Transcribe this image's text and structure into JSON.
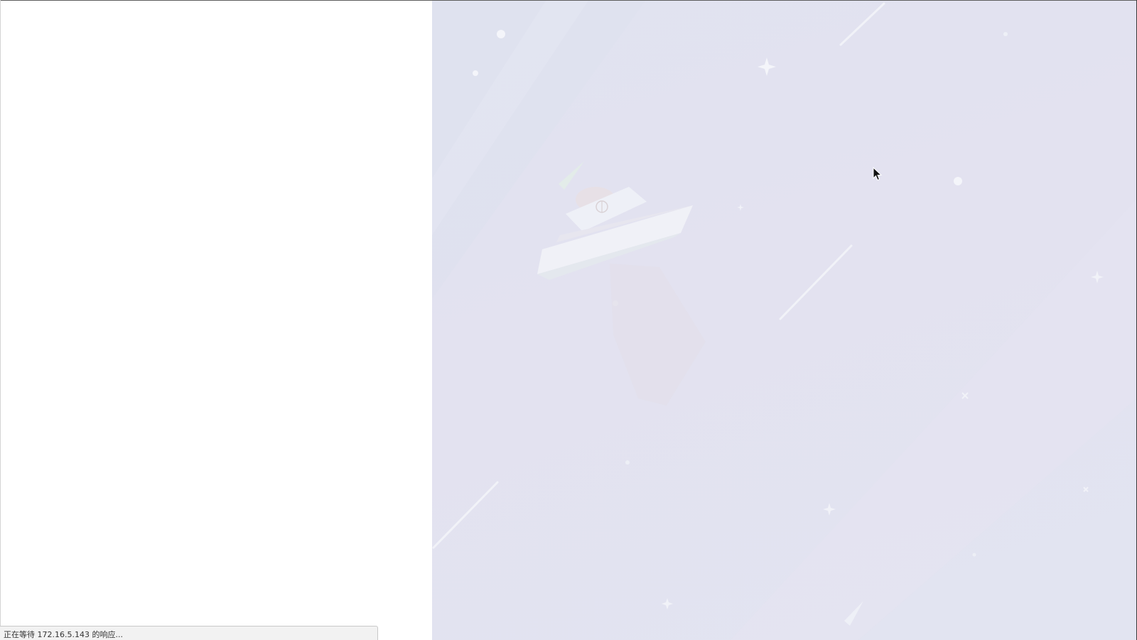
{
  "status_bar": {
    "text": "正在等待 172.16.5.143 的响应..."
  },
  "scene": {
    "background_color": "#e1e3f0",
    "illustration": "ufo-icon"
  },
  "cursor": {
    "icon": "mouse-pointer-icon"
  }
}
